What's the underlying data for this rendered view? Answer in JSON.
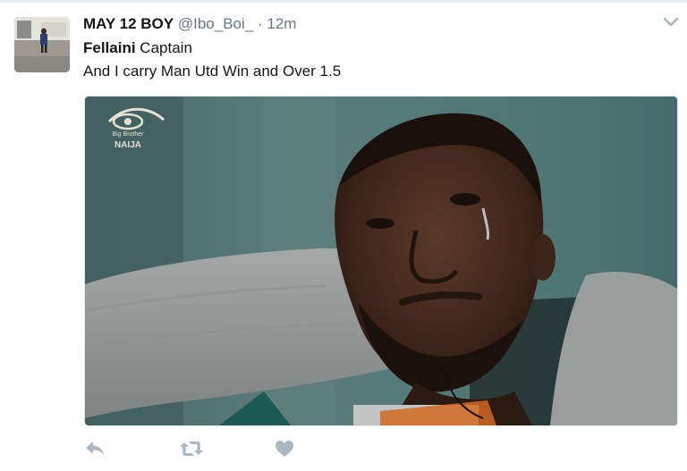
{
  "tweet": {
    "display_name": "MAY 12 BOY",
    "handle": "@Ibo_Boi_",
    "separator": "·",
    "time": "12m",
    "text_bold": "Fellaini",
    "text_line1_rest": " Captain",
    "text_line2": "And I carry Man Utd Win and Over 1.5"
  },
  "media": {
    "watermark": "Big Brother NAIJA"
  },
  "actions": {
    "icons": [
      "reply-icon",
      "retweet-icon",
      "like-icon"
    ]
  },
  "colors": {
    "name": "#14171a",
    "secondary": "#657786",
    "action_icon": "#aab8c2",
    "background": "#ffffff"
  }
}
